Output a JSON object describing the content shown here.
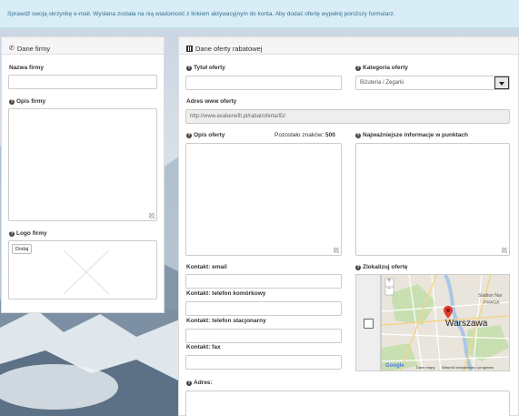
{
  "alert": {
    "text": "Sprawdź swoją skrzynkę e-mail. Wysłana została na nią wiadomość z linkiem aktywacyjnym do konta. Aby dodać ofertę wypełnij poniższy formularz."
  },
  "company_panel": {
    "title": "Dane firmy",
    "name_label": "Nazwa firmy",
    "name_value": "",
    "desc_label": "Opis firmy",
    "logo_label": "Logo firmy",
    "add_button": "Dodaj"
  },
  "offer_panel": {
    "title": "Dane oferty rabatowej",
    "title_label": "Tytuł oferty",
    "title_value": "",
    "category_label": "Kategoria oferty",
    "category_value": "Biżuteria / Zegarki",
    "url_label": "Adres www oferty",
    "url_value": "http://www.axabenefit.pl/rabat/oferta/ID/",
    "desc_label": "Opis oferty",
    "remaining_label": "Pozostało znaków:",
    "remaining_count": "500",
    "highlights_label": "Najważniejsze informacje w punktach",
    "email_label": "Kontakt: email",
    "mobile_label": "Kontakt: telefon komórkowy",
    "landline_label": "Kontakt: telefon stacjonarny",
    "fax_label": "Kontakt: fax",
    "locate_label": "Zlokalizuj ofertę",
    "address_label": "Adres:"
  },
  "map": {
    "city": "Warszawa",
    "district1": "Stadion Nar",
    "district2": "PRAGA",
    "attribution": "Dane mapy",
    "terms": "Warunki korzystania z programu",
    "google": "Google",
    "zoom_in": "+",
    "zoom_out": "−"
  },
  "colors": {
    "alert_bg": "#d9edf7",
    "alert_text": "#31708f",
    "pin": "#e23b2e"
  }
}
